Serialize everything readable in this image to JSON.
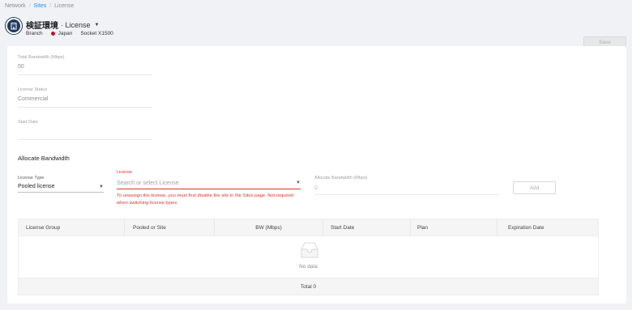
{
  "breadcrumb": {
    "items": [
      {
        "label": "Network"
      },
      {
        "label": "Sites"
      },
      {
        "label": "License"
      }
    ],
    "separator": "/"
  },
  "header": {
    "title": "検証環境",
    "subtitle": "· License",
    "meta": {
      "type": "Branch",
      "country": "Japan",
      "device": "Socket X1500"
    },
    "avatar_icon": "site-building-icon",
    "save_label": "Save"
  },
  "info_fields": [
    {
      "label": "Total Bandwidth (Mbps)",
      "value": "50"
    },
    {
      "label": "License Status",
      "value": "Commercial"
    },
    {
      "label": "Start Date",
      "value": ""
    }
  ],
  "allocate": {
    "section_title": "Allocate Bandwidth",
    "license_type": {
      "label": "License Type",
      "value": "Pooled license"
    },
    "license": {
      "label": "License",
      "placeholder": "Search or select License",
      "error": "To unassign the license, you must first disable the site in the Sites page. Not required when switching license types"
    },
    "allocate_bandwidth": {
      "label": "Allocate Bandwidth (Mbps)",
      "value": "0"
    },
    "add_label": "Add"
  },
  "table": {
    "columns": [
      "License Group",
      "Pooled or Site",
      "BW (Mbps)",
      "Start Date",
      "Plan",
      "Expiration Date"
    ],
    "empty_text": "No data",
    "footer": "Total 0"
  },
  "colors": {
    "accent": "#1890ff",
    "error": "#e0342b",
    "avatar": "#1f3a5f",
    "flag": "#c8102e"
  }
}
